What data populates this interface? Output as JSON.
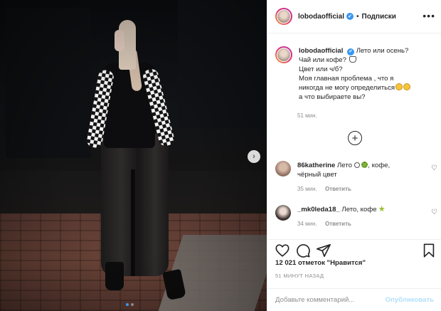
{
  "header": {
    "username": "lobodaofficial",
    "verified_mark": "✔",
    "separator": "•",
    "follow_label": "Подписки",
    "more_label": "•••"
  },
  "photo": {
    "next_arrow": "›",
    "carousel_count": 2,
    "carousel_active": 1
  },
  "caption": {
    "username": "lobodaofficial",
    "lines": [
      "Лето или осень?",
      "Чай или кофе?",
      "Цвет или ч/б?",
      "Моя главная проблема , что я",
      "никогда не могу определиться",
      "а что выбираете вы?"
    ],
    "time": "51 мин."
  },
  "add_more_icon": "+",
  "comments": [
    {
      "username": "86katherine",
      "text_a": "Лето",
      "text_b": ", кофе,",
      "text_c": "чёрный цвет",
      "time": "35 мин.",
      "reply": "Ответить"
    },
    {
      "username": "_mk0leda18_",
      "text_a": "Лето, кофе",
      "time": "34 мин.",
      "reply": "Ответить"
    }
  ],
  "actions": {
    "likes": "12 021 отметок \"Нравится\"",
    "ago": "51 МИНУТ НАЗАД"
  },
  "add_comment": {
    "placeholder": "Добавьте комментарий...",
    "post_label": "Опубликовать"
  },
  "colors": {
    "accent": "#3897f0",
    "post_disabled": "#b2dffc",
    "muted": "#8e8e8e"
  }
}
